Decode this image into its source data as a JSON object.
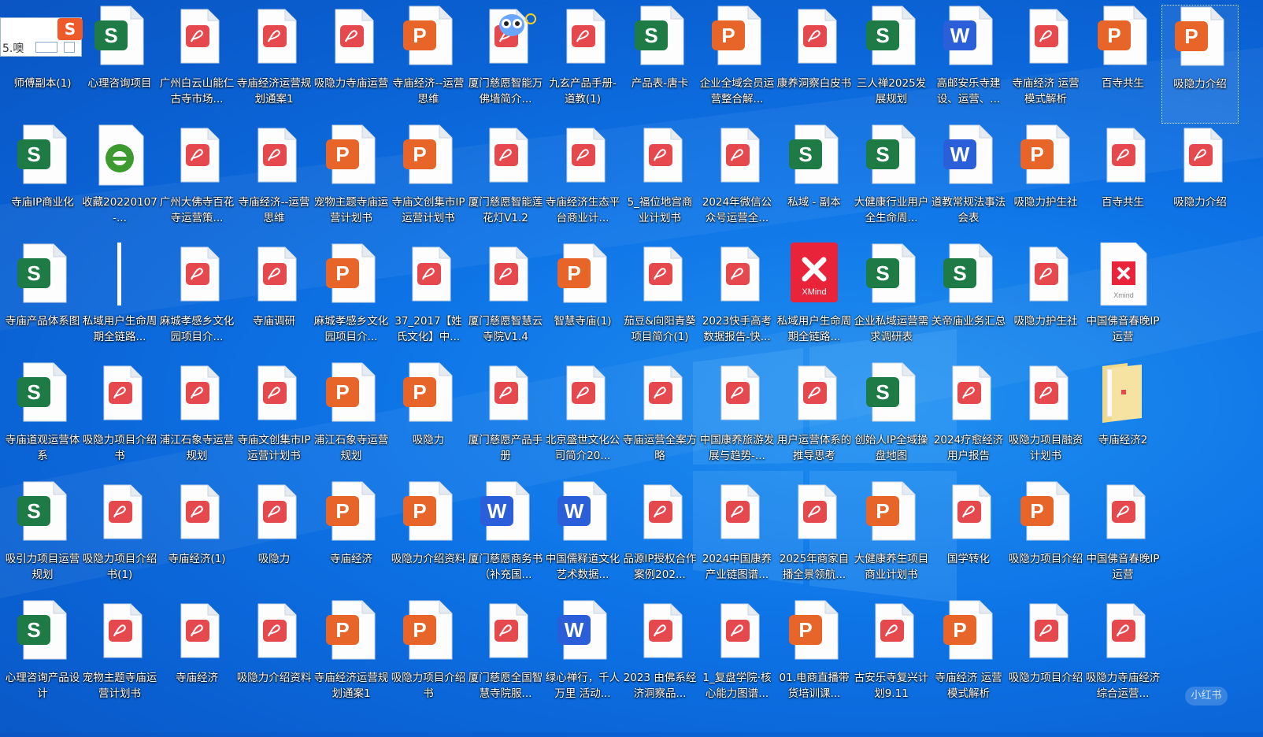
{
  "colors": {
    "excel": "#1e7b45",
    "word": "#2b5fd9",
    "ppt": "#e8652a",
    "pdf": "#e5484d",
    "xmind": "#e8233a"
  },
  "widget": {
    "text": "5.噢",
    "logo": "S"
  },
  "watermark": "小红书",
  "icons": [
    {
      "label": "师傅副本(1)",
      "type": "none"
    },
    {
      "label": "心理咨询项目",
      "type": "excel"
    },
    {
      "label": "广州白云山能仁古寺市场...",
      "type": "pdf"
    },
    {
      "label": "寺庙经济运营规划通案1",
      "type": "pdf"
    },
    {
      "label": "吸隐力寺庙运营",
      "type": "pdf"
    },
    {
      "label": "寺庙经济--运营思维",
      "type": "ppt"
    },
    {
      "label": "厦门慈愿智能万佛墙简介...",
      "type": "pdf"
    },
    {
      "label": "九玄产品手册-道教(1)",
      "type": "pdf"
    },
    {
      "label": "产品表-唐卡",
      "type": "excel"
    },
    {
      "label": "企业全域会员运营整合解...",
      "type": "ppt"
    },
    {
      "label": "康养洞察白皮书",
      "type": "pdf"
    },
    {
      "label": "三人禅2025发展规划",
      "type": "excel"
    },
    {
      "label": "高邮安乐寺建设、运营、...",
      "type": "word"
    },
    {
      "label": "寺庙经济 运营模式解析",
      "type": "pdf"
    },
    {
      "label": "百寺共生",
      "type": "ppt"
    },
    {
      "label": "吸隐力介绍",
      "type": "ppt",
      "selected": true
    },
    {
      "label": "寺庙IP商业化",
      "type": "excel"
    },
    {
      "label": "收藏20220107-...",
      "type": "ie"
    },
    {
      "label": "广州大佛寺百花寺运营策...",
      "type": "pdf"
    },
    {
      "label": "寺庙经济--运营思维",
      "type": "pdf"
    },
    {
      "label": "宠物主题寺庙运营计划书",
      "type": "ppt"
    },
    {
      "label": "寺庙文创集市IP运营计划书",
      "type": "ppt"
    },
    {
      "label": "厦门慈愿智能莲花灯V1.2",
      "type": "pdf"
    },
    {
      "label": "寺庙经济生态平台商业计...",
      "type": "pdf"
    },
    {
      "label": "5_福位地宫商业计划书",
      "type": "pdf"
    },
    {
      "label": "2024年微信公众号运营全...",
      "type": "pdf"
    },
    {
      "label": "私域 - 副本",
      "type": "excel"
    },
    {
      "label": "大健康行业用户全生命周...",
      "type": "excel"
    },
    {
      "label": "道教常规法事法会表",
      "type": "word"
    },
    {
      "label": "吸隐力护生社",
      "type": "ppt"
    },
    {
      "label": "百寺共生",
      "type": "pdf"
    },
    {
      "label": "吸隐力介绍",
      "type": "pdf"
    },
    {
      "label": "寺庙产品体系图",
      "type": "excel"
    },
    {
      "label": "私域用户生命周期全链路...",
      "type": "line"
    },
    {
      "label": "麻城孝感乡文化园项目介...",
      "type": "pdf"
    },
    {
      "label": "寺庙调研",
      "type": "pdf"
    },
    {
      "label": "麻城孝感乡文化园项目介...",
      "type": "ppt"
    },
    {
      "label": "37_2017【姓氏文化】中...",
      "type": "pdf"
    },
    {
      "label": "厦门慈愿智慧云寺院V1.4",
      "type": "pdf"
    },
    {
      "label": "智慧寺庙(1)",
      "type": "ppt"
    },
    {
      "label": "茄豆&向阳青葵项目简介(1)",
      "type": "pdf"
    },
    {
      "label": "2023快手高考数据报告-快...",
      "type": "pdf"
    },
    {
      "label": "私域用户生命周期全链路...",
      "type": "xmind"
    },
    {
      "label": "企业私域运营需求调研表",
      "type": "excel"
    },
    {
      "label": "关帝庙业务汇总",
      "type": "excel"
    },
    {
      "label": "吸隐力护生社",
      "type": "pdf"
    },
    {
      "label": "中国佛音春晚IP运营",
      "type": "xmindfile"
    },
    {
      "label": "",
      "type": "none"
    },
    {
      "label": "寺庙道观运营体系",
      "type": "excel"
    },
    {
      "label": "吸隐力项目介绍书",
      "type": "pdf"
    },
    {
      "label": "浦江石象寺运营规划",
      "type": "pdf"
    },
    {
      "label": "寺庙文创集市IP运营计划书",
      "type": "pdf"
    },
    {
      "label": "浦江石象寺运营规划",
      "type": "ppt"
    },
    {
      "label": "吸隐力",
      "type": "ppt"
    },
    {
      "label": "厦门慈愿产品手册",
      "type": "pdf"
    },
    {
      "label": "北京盛世文化公司简介20...",
      "type": "pdf"
    },
    {
      "label": "寺庙运营全案方略",
      "type": "pdf"
    },
    {
      "label": "中国康养旅游发展与趋势-...",
      "type": "pdf"
    },
    {
      "label": "用户运营体系的推导思考",
      "type": "pdf"
    },
    {
      "label": "创始人IP全域操盘地图",
      "type": "excel"
    },
    {
      "label": "2024疗愈经济用户报告",
      "type": "pdf"
    },
    {
      "label": "吸隐力项目融资计划书",
      "type": "pdf"
    },
    {
      "label": "寺庙经济2",
      "type": "folder"
    },
    {
      "label": "",
      "type": "none"
    },
    {
      "label": "吸引力项目运营规划",
      "type": "excel"
    },
    {
      "label": "吸隐力项目介绍书(1)",
      "type": "pdf"
    },
    {
      "label": "寺庙经济(1)",
      "type": "pdf"
    },
    {
      "label": "吸隐力",
      "type": "pdf"
    },
    {
      "label": "寺庙经济",
      "type": "ppt"
    },
    {
      "label": "吸隐力介绍资料",
      "type": "ppt"
    },
    {
      "label": "厦门慈愿商务书（补充国...",
      "type": "word"
    },
    {
      "label": "中国儒释道文化艺术数据...",
      "type": "word"
    },
    {
      "label": "品源IP授权合作案例202...",
      "type": "pdf"
    },
    {
      "label": "2024中国康养产业链图谱...",
      "type": "pdf"
    },
    {
      "label": "2025年商家自播全景领航...",
      "type": "pdf"
    },
    {
      "label": "大健康养生项目商业计划书",
      "type": "ppt"
    },
    {
      "label": "国学转化",
      "type": "pdf"
    },
    {
      "label": "吸隐力项目介绍",
      "type": "ppt"
    },
    {
      "label": "中国佛音春晚IP运营",
      "type": "pdf"
    },
    {
      "label": "",
      "type": "none"
    },
    {
      "label": "心理咨询产品设计",
      "type": "excel"
    },
    {
      "label": "宠物主题寺庙运营计划书",
      "type": "pdf"
    },
    {
      "label": "寺庙经济",
      "type": "pdf"
    },
    {
      "label": "吸隐力介绍资料",
      "type": "pdf"
    },
    {
      "label": "寺庙经济运营规划通案1",
      "type": "ppt"
    },
    {
      "label": "吸隐力项目介绍书",
      "type": "ppt"
    },
    {
      "label": "厦门慈愿全国智慧寺院服...",
      "type": "pdf"
    },
    {
      "label": "绿心禅行，千人万里 活动...",
      "type": "word"
    },
    {
      "label": "2023 由佛系经济洞察品...",
      "type": "pdf"
    },
    {
      "label": "1_复盘学院·核心能力图谱...",
      "type": "pdf"
    },
    {
      "label": "01.电商直播带货培训课...",
      "type": "ppt"
    },
    {
      "label": "古安乐寺复兴计划9.11",
      "type": "pdf"
    },
    {
      "label": "寺庙经济 运营模式解析",
      "type": "ppt"
    },
    {
      "label": "吸隐力项目介绍",
      "type": "pdf"
    },
    {
      "label": "吸隐力寺庙经济综合运营...",
      "type": "pdf"
    },
    {
      "label": "",
      "type": "none"
    }
  ]
}
